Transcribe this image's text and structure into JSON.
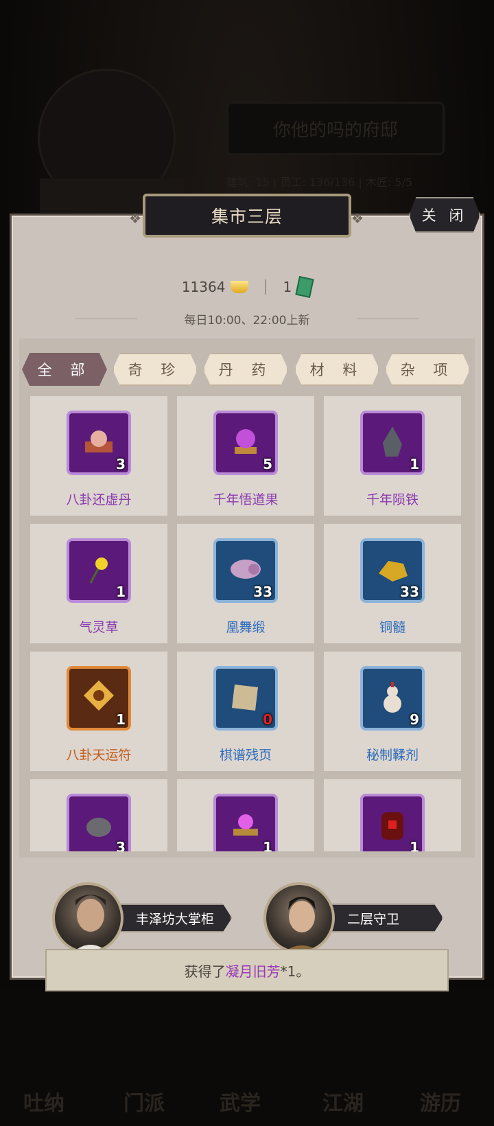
{
  "background": {
    "estate_name": "你他的吗的府邸",
    "stats": "建筑: 15 | 员工: 136/136 | 木匠: 5/5",
    "nav": [
      "吐纳",
      "门派",
      "武学",
      "江湖",
      "游历"
    ]
  },
  "panel": {
    "title": "集市三层",
    "close_label": "关 闭"
  },
  "currency": {
    "gold": "11364",
    "jade": "1"
  },
  "refresh_text": "每日10:00、22:00上新",
  "tabs": [
    {
      "label": "全 部",
      "active": true
    },
    {
      "label": "奇 珍",
      "active": false
    },
    {
      "label": "丹 药",
      "active": false
    },
    {
      "label": "材 料",
      "active": false
    },
    {
      "label": "杂 项",
      "active": false
    }
  ],
  "items": [
    {
      "name": "八卦还虚丹",
      "count": "3",
      "rarity": "purple",
      "icon": "pill-box-icon"
    },
    {
      "name": "千年悟道果",
      "count": "5",
      "rarity": "purple",
      "icon": "fruit-icon"
    },
    {
      "name": "千年陨铁",
      "count": "1",
      "rarity": "purple",
      "icon": "meteorite-icon"
    },
    {
      "name": "气灵草",
      "count": "1",
      "rarity": "purple",
      "icon": "herb-icon"
    },
    {
      "name": "凰舞缎",
      "count": "33",
      "rarity": "blue",
      "icon": "silk-roll-icon"
    },
    {
      "name": "铜髓",
      "count": "33",
      "rarity": "blue",
      "icon": "copper-ore-icon"
    },
    {
      "name": "八卦天运符",
      "count": "1",
      "rarity": "orange",
      "icon": "talisman-icon"
    },
    {
      "name": "棋谱残页",
      "count": "0",
      "rarity": "blue",
      "icon": "scroll-page-icon"
    },
    {
      "name": "秘制鞣剂",
      "count": "9",
      "rarity": "blue",
      "icon": "gourd-icon"
    },
    {
      "name": "",
      "count": "3",
      "rarity": "purple",
      "icon": "stone-icon"
    },
    {
      "name": "",
      "count": "1",
      "rarity": "purple",
      "icon": "orb-box-icon"
    },
    {
      "name": "",
      "count": "1",
      "rarity": "purple",
      "icon": "jar-icon"
    }
  ],
  "npcs": [
    {
      "name": "丰泽坊大掌柜"
    },
    {
      "name": "二层守卫"
    }
  ],
  "toast": {
    "prefix": "获得了",
    "item": "凝月旧芳",
    "suffix": "*1。"
  },
  "colors": {
    "rarity_purple": "#8a3ab0",
    "rarity_blue": "#2e6dbd",
    "rarity_orange": "#c25a18",
    "tab_active": "#7b6066"
  }
}
